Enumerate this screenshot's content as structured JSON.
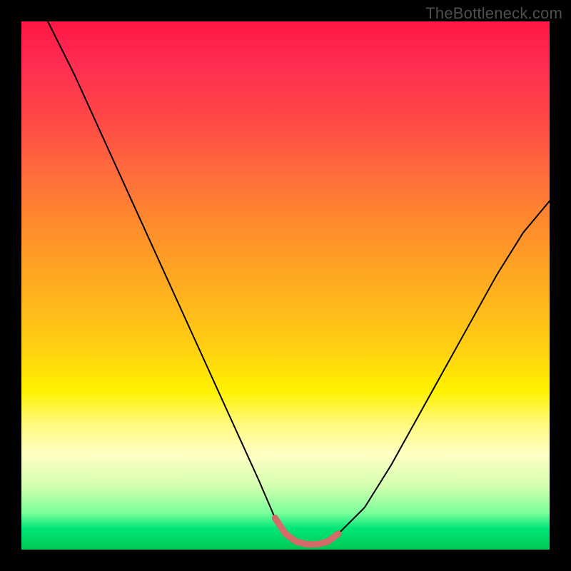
{
  "chart_data": {
    "type": "line",
    "title": "",
    "xlabel": "",
    "ylabel": "",
    "xlim": [
      0,
      100
    ],
    "ylim": [
      0,
      100
    ],
    "series": [
      {
        "name": "bottleneck-curve",
        "color": "#000000",
        "x": [
          5,
          10,
          15,
          20,
          25,
          30,
          35,
          40,
          45,
          48,
          50,
          52,
          54,
          56,
          58,
          60,
          65,
          70,
          75,
          80,
          85,
          90,
          95,
          100
        ],
        "values": [
          100,
          90,
          79,
          68,
          57,
          46,
          35,
          24,
          13,
          6,
          3,
          1.5,
          1,
          1,
          1.5,
          3,
          8,
          16,
          25,
          34,
          43,
          52,
          60,
          66
        ]
      },
      {
        "name": "highlight-band",
        "color": "#d46a6a",
        "x": [
          48,
          50,
          52,
          54,
          56,
          58,
          60
        ],
        "values": [
          6,
          3,
          1.5,
          1,
          1,
          1.5,
          3
        ]
      }
    ],
    "annotations": [
      {
        "text": "TheBottleneck.com",
        "role": "watermark"
      }
    ],
    "background_gradient": {
      "top": "#ff1744",
      "mid": "#ffd011",
      "bottom": "#00c853"
    }
  },
  "watermark_text": "TheBottleneck.com"
}
